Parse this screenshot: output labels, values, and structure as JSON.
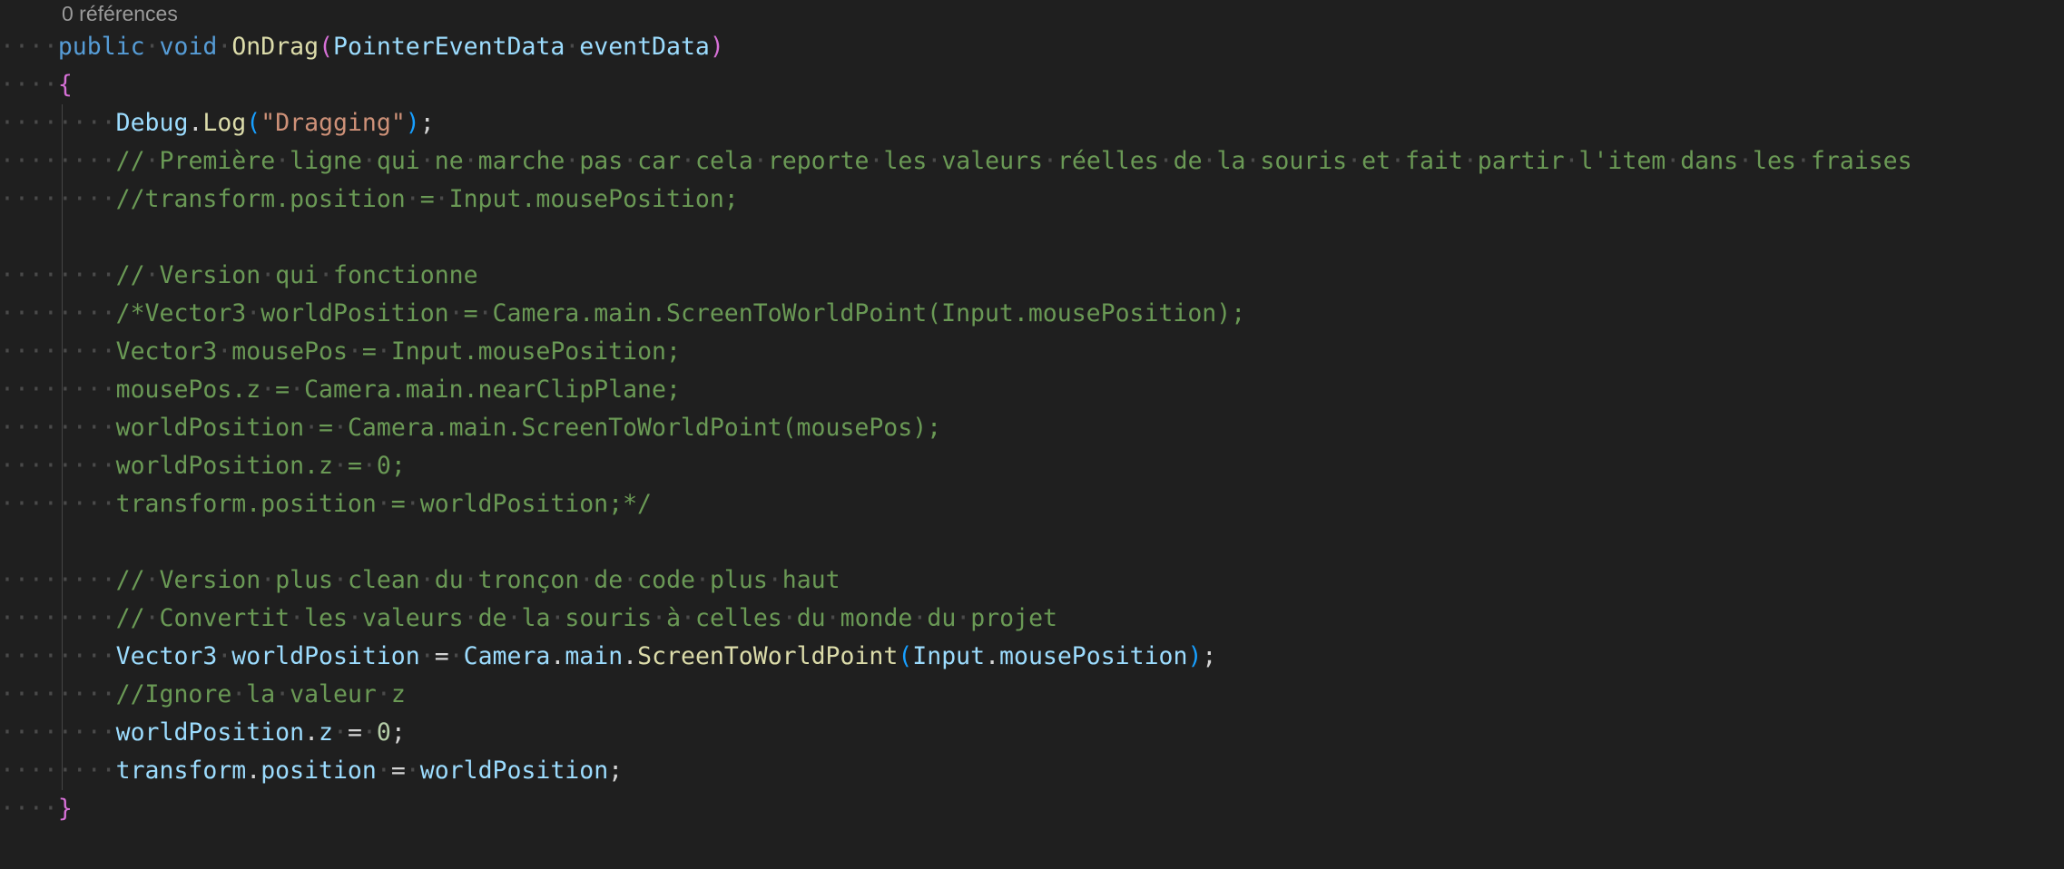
{
  "codelens": {
    "references": "0 références"
  },
  "lines": [
    {
      "indent": "····",
      "tokens": [
        {
          "c": "kw",
          "t": "public"
        },
        {
          "c": "ws",
          "t": "·"
        },
        {
          "c": "kw",
          "t": "void"
        },
        {
          "c": "ws",
          "t": "·"
        },
        {
          "c": "fn",
          "t": "OnDrag"
        },
        {
          "c": "br1",
          "t": "("
        },
        {
          "c": "id",
          "t": "PointerEventData"
        },
        {
          "c": "ws",
          "t": "·"
        },
        {
          "c": "id",
          "t": "eventData"
        },
        {
          "c": "br1",
          "t": ")"
        }
      ]
    },
    {
      "indent": "····",
      "tokens": [
        {
          "c": "br1",
          "t": "{"
        }
      ]
    },
    {
      "indent": "········",
      "tokens": [
        {
          "c": "id",
          "t": "Debug"
        },
        {
          "c": "pl",
          "t": "."
        },
        {
          "c": "fn",
          "t": "Log"
        },
        {
          "c": "br2",
          "t": "("
        },
        {
          "c": "str",
          "t": "\"Dragging\""
        },
        {
          "c": "br2",
          "t": ")"
        },
        {
          "c": "pl",
          "t": ";"
        }
      ]
    },
    {
      "indent": "········",
      "tokens": [
        {
          "c": "cm",
          "t": "//·Première·ligne·qui·ne·marche·pas·car·cela·reporte·les·valeurs·réelles·de·la·souris·et·fait·partir·l'item·dans·les·fraises"
        }
      ]
    },
    {
      "indent": "········",
      "tokens": [
        {
          "c": "cm",
          "t": "//transform.position·=·Input.mousePosition;"
        }
      ]
    },
    {
      "indent": "",
      "tokens": []
    },
    {
      "indent": "········",
      "tokens": [
        {
          "c": "cm",
          "t": "//·Version·qui·fonctionne"
        }
      ]
    },
    {
      "indent": "········",
      "tokens": [
        {
          "c": "cm",
          "t": "/*Vector3·worldPosition·=·Camera.main.ScreenToWorldPoint(Input.mousePosition);"
        }
      ]
    },
    {
      "indent": "········",
      "tokens": [
        {
          "c": "cm",
          "t": "Vector3·mousePos·=·Input.mousePosition;"
        }
      ]
    },
    {
      "indent": "········",
      "tokens": [
        {
          "c": "cm",
          "t": "mousePos.z·=·Camera.main.nearClipPlane;"
        }
      ]
    },
    {
      "indent": "········",
      "tokens": [
        {
          "c": "cm",
          "t": "worldPosition·=·Camera.main.ScreenToWorldPoint(mousePos);"
        }
      ]
    },
    {
      "indent": "········",
      "tokens": [
        {
          "c": "cm",
          "t": "worldPosition.z·=·0;"
        }
      ]
    },
    {
      "indent": "········",
      "tokens": [
        {
          "c": "cm",
          "t": "transform.position·=·worldPosition;*/"
        }
      ]
    },
    {
      "indent": "",
      "tokens": []
    },
    {
      "indent": "········",
      "tokens": [
        {
          "c": "cm",
          "t": "//·Version·plus·clean·du·tronçon·de·code·plus·haut"
        }
      ]
    },
    {
      "indent": "········",
      "tokens": [
        {
          "c": "cm",
          "t": "//·Convertit·les·valeurs·de·la·souris·à·celles·du·monde·du·projet"
        }
      ]
    },
    {
      "indent": "········",
      "tokens": [
        {
          "c": "id",
          "t": "Vector3"
        },
        {
          "c": "ws",
          "t": "·"
        },
        {
          "c": "id",
          "t": "worldPosition"
        },
        {
          "c": "ws",
          "t": "·"
        },
        {
          "c": "pl",
          "t": "="
        },
        {
          "c": "ws",
          "t": "·"
        },
        {
          "c": "id",
          "t": "Camera"
        },
        {
          "c": "pl",
          "t": "."
        },
        {
          "c": "id",
          "t": "main"
        },
        {
          "c": "pl",
          "t": "."
        },
        {
          "c": "fn",
          "t": "ScreenToWorldPoint"
        },
        {
          "c": "br2",
          "t": "("
        },
        {
          "c": "id",
          "t": "Input"
        },
        {
          "c": "pl",
          "t": "."
        },
        {
          "c": "id",
          "t": "mousePosition"
        },
        {
          "c": "br2",
          "t": ")"
        },
        {
          "c": "pl",
          "t": ";"
        }
      ]
    },
    {
      "indent": "········",
      "tokens": [
        {
          "c": "cm",
          "t": "//Ignore·la·valeur·z"
        }
      ]
    },
    {
      "indent": "········",
      "tokens": [
        {
          "c": "id",
          "t": "worldPosition"
        },
        {
          "c": "pl",
          "t": "."
        },
        {
          "c": "id",
          "t": "z"
        },
        {
          "c": "ws",
          "t": "·"
        },
        {
          "c": "pl",
          "t": "="
        },
        {
          "c": "ws",
          "t": "·"
        },
        {
          "c": "num",
          "t": "0"
        },
        {
          "c": "pl",
          "t": ";"
        }
      ]
    },
    {
      "indent": "········",
      "tokens": [
        {
          "c": "id",
          "t": "transform"
        },
        {
          "c": "pl",
          "t": "."
        },
        {
          "c": "id",
          "t": "position"
        },
        {
          "c": "ws",
          "t": "·"
        },
        {
          "c": "pl",
          "t": "="
        },
        {
          "c": "ws",
          "t": "·"
        },
        {
          "c": "id",
          "t": "worldPosition"
        },
        {
          "c": "pl",
          "t": ";"
        }
      ]
    },
    {
      "indent": "····",
      "tokens": [
        {
          "c": "br1",
          "t": "}"
        }
      ]
    }
  ]
}
